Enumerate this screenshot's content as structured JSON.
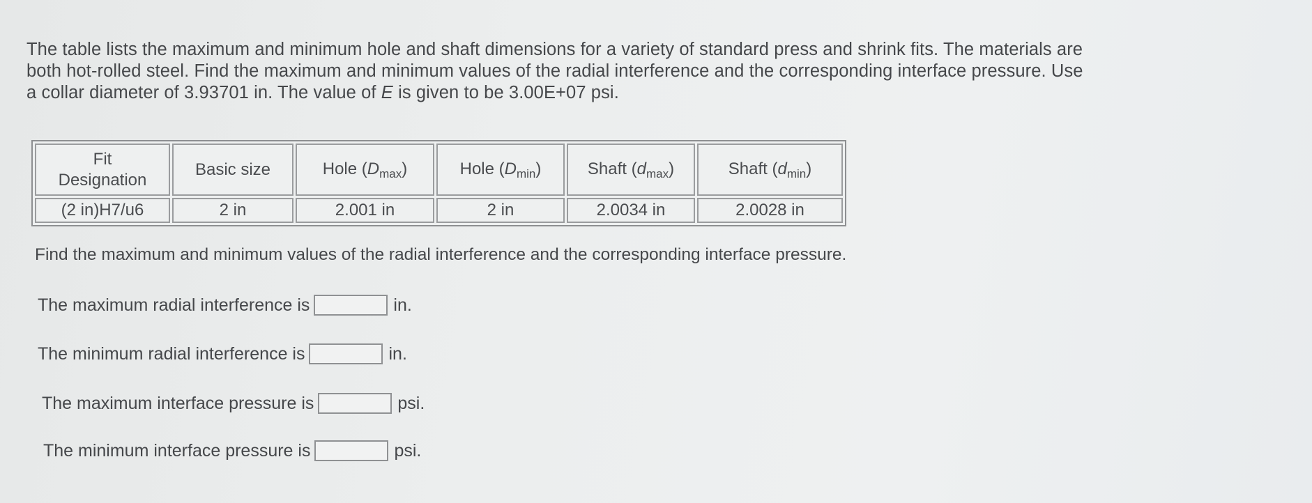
{
  "intro": {
    "line1": "The table lists the maximum and minimum hole and shaft dimensions for a variety of standard press and shrink fits. The materials are",
    "line2": "both hot-rolled steel. Find the maximum and minimum values of the radial interference and the corresponding interface pressure. Use",
    "line3_before_E": "a collar diameter of 3.93701 in. The value of ",
    "line3_E": "E",
    "line3_after_E": " is given to be 3.00E+07 psi."
  },
  "table": {
    "headers": [
      {
        "line1": "Fit",
        "line2": "Designation"
      },
      {
        "text": "Basic size"
      },
      {
        "prefix": "Hole (",
        "var": "D",
        "sub": "max",
        "suffix": ")"
      },
      {
        "prefix": "Hole (",
        "var": "D",
        "sub": "min",
        "suffix": ")"
      },
      {
        "prefix": "Shaft (",
        "var": "d",
        "sub": "max",
        "suffix": ")"
      },
      {
        "prefix": "Shaft (",
        "var": "d",
        "sub": "min",
        "suffix": ")"
      }
    ],
    "rows": [
      [
        "(2 in)H7/u6",
        "2 in",
        "2.001 in",
        "2 in",
        "2.0034 in",
        "2.0028 in"
      ]
    ]
  },
  "prompt": "Find the maximum and minimum values of the radial interference and the corresponding interface pressure.",
  "answers": [
    {
      "label": "The maximum radial interference is",
      "value": "",
      "unit": "in."
    },
    {
      "label": "The minimum radial interference is",
      "value": "",
      "unit": "in."
    },
    {
      "label": "The maximum interface pressure is",
      "value": "",
      "unit": "psi."
    },
    {
      "label": "The minimum interface pressure is",
      "value": "",
      "unit": "psi."
    }
  ]
}
